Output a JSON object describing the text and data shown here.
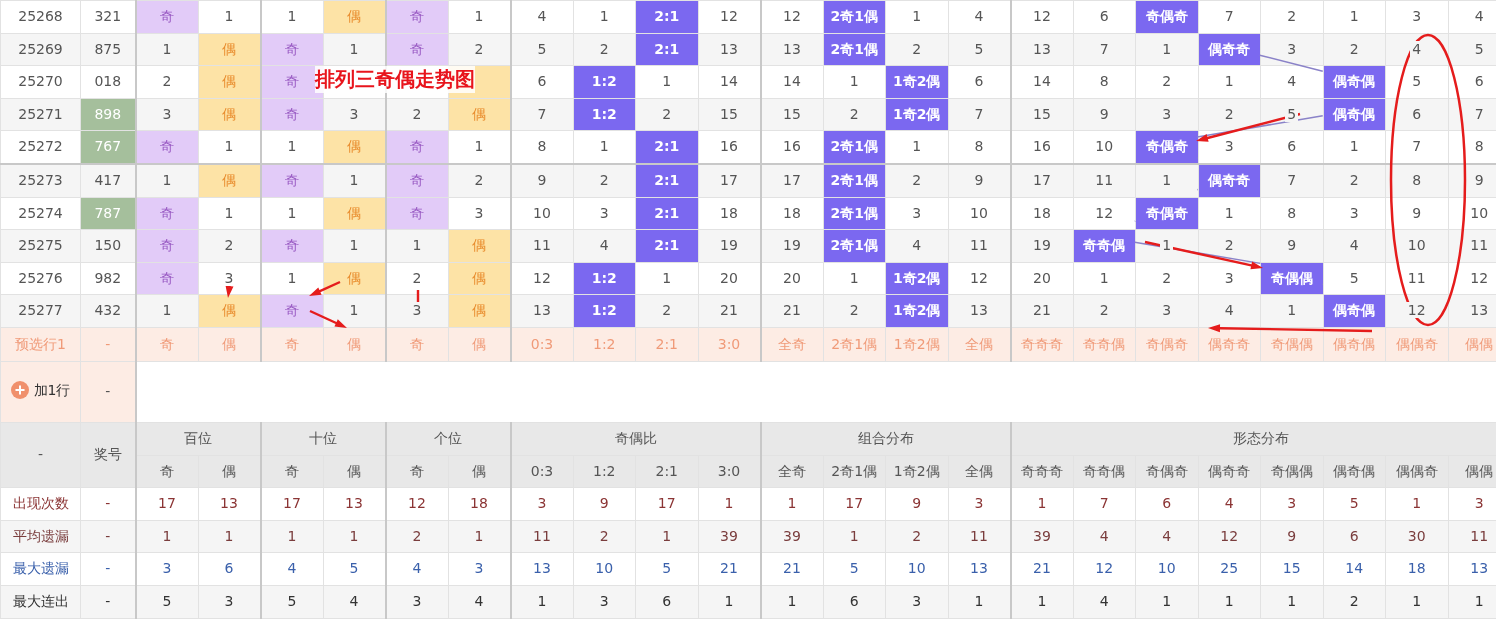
{
  "annotation": {
    "title": "排列三奇偶走势图"
  },
  "draws": [
    {
      "issue": "25268",
      "number": "321",
      "highlighted": false,
      "cells": [
        {
          "text": "奇",
          "kind": "odd"
        },
        {
          "text": "1",
          "kind": "plain"
        },
        {
          "text": "1",
          "kind": "plain"
        },
        {
          "text": "偶",
          "kind": "even"
        },
        {
          "text": "奇",
          "kind": "odd"
        },
        {
          "text": "1",
          "kind": "plain"
        },
        {
          "text": "4",
          "kind": "plain"
        },
        {
          "text": "1",
          "kind": "plain"
        },
        {
          "text": "2:1",
          "kind": "hit"
        },
        {
          "text": "12",
          "kind": "plain"
        },
        {
          "text": "12",
          "kind": "plain"
        },
        {
          "text": "2奇1偶",
          "kind": "hit"
        },
        {
          "text": "1",
          "kind": "plain"
        },
        {
          "text": "4",
          "kind": "plain"
        },
        {
          "text": "12",
          "kind": "plain"
        },
        {
          "text": "6",
          "kind": "plain"
        },
        {
          "text": "奇偶奇",
          "kind": "hit"
        },
        {
          "text": "7",
          "kind": "plain"
        },
        {
          "text": "2",
          "kind": "plain"
        },
        {
          "text": "1",
          "kind": "plain"
        },
        {
          "text": "3",
          "kind": "plain"
        },
        {
          "text": "4",
          "kind": "plain"
        }
      ]
    },
    {
      "issue": "25269",
      "number": "875",
      "highlighted": false,
      "cells": [
        {
          "text": "1",
          "kind": "plain"
        },
        {
          "text": "偶",
          "kind": "even"
        },
        {
          "text": "奇",
          "kind": "odd"
        },
        {
          "text": "1",
          "kind": "plain"
        },
        {
          "text": "奇",
          "kind": "odd"
        },
        {
          "text": "2",
          "kind": "plain"
        },
        {
          "text": "5",
          "kind": "plain"
        },
        {
          "text": "2",
          "kind": "plain"
        },
        {
          "text": "2:1",
          "kind": "hit"
        },
        {
          "text": "13",
          "kind": "plain"
        },
        {
          "text": "13",
          "kind": "plain"
        },
        {
          "text": "2奇1偶",
          "kind": "hit"
        },
        {
          "text": "2",
          "kind": "plain"
        },
        {
          "text": "5",
          "kind": "plain"
        },
        {
          "text": "13",
          "kind": "plain"
        },
        {
          "text": "7",
          "kind": "plain"
        },
        {
          "text": "1",
          "kind": "plain"
        },
        {
          "text": "偶奇奇",
          "kind": "hit"
        },
        {
          "text": "3",
          "kind": "plain"
        },
        {
          "text": "2",
          "kind": "plain"
        },
        {
          "text": "4",
          "kind": "plain"
        },
        {
          "text": "5",
          "kind": "plain"
        }
      ]
    },
    {
      "issue": "25270",
      "number": "018",
      "highlighted": false,
      "cells": [
        {
          "text": "2",
          "kind": "plain"
        },
        {
          "text": "偶",
          "kind": "even"
        },
        {
          "text": "奇",
          "kind": "odd"
        },
        {
          "kind": "plain"
        },
        {
          "kind": "plain"
        },
        {
          "kind": "even"
        },
        {
          "text": "6",
          "kind": "plain"
        },
        {
          "text": "1:2",
          "kind": "hit"
        },
        {
          "text": "1",
          "kind": "plain"
        },
        {
          "text": "14",
          "kind": "plain"
        },
        {
          "text": "14",
          "kind": "plain"
        },
        {
          "text": "1",
          "kind": "plain"
        },
        {
          "text": "1奇2偶",
          "kind": "hit"
        },
        {
          "text": "6",
          "kind": "plain"
        },
        {
          "text": "14",
          "kind": "plain"
        },
        {
          "text": "8",
          "kind": "plain"
        },
        {
          "text": "2",
          "kind": "plain"
        },
        {
          "text": "1",
          "kind": "plain"
        },
        {
          "text": "4",
          "kind": "plain"
        },
        {
          "text": "偶奇偶",
          "kind": "hit"
        },
        {
          "text": "5",
          "kind": "plain"
        },
        {
          "text": "6",
          "kind": "plain"
        }
      ]
    },
    {
      "issue": "25271",
      "number": "898",
      "highlighted": true,
      "cells": [
        {
          "text": "3",
          "kind": "plain"
        },
        {
          "text": "偶",
          "kind": "even"
        },
        {
          "text": "奇",
          "kind": "odd"
        },
        {
          "text": "3",
          "kind": "plain"
        },
        {
          "text": "2",
          "kind": "plain"
        },
        {
          "text": "偶",
          "kind": "even"
        },
        {
          "text": "7",
          "kind": "plain"
        },
        {
          "text": "1:2",
          "kind": "hit"
        },
        {
          "text": "2",
          "kind": "plain"
        },
        {
          "text": "15",
          "kind": "plain"
        },
        {
          "text": "15",
          "kind": "plain"
        },
        {
          "text": "2",
          "kind": "plain"
        },
        {
          "text": "1奇2偶",
          "kind": "hit"
        },
        {
          "text": "7",
          "kind": "plain"
        },
        {
          "text": "15",
          "kind": "plain"
        },
        {
          "text": "9",
          "kind": "plain"
        },
        {
          "text": "3",
          "kind": "plain"
        },
        {
          "text": "2",
          "kind": "plain"
        },
        {
          "text": "5",
          "kind": "plain"
        },
        {
          "text": "偶奇偶",
          "kind": "hit"
        },
        {
          "text": "6",
          "kind": "plain"
        },
        {
          "text": "7",
          "kind": "plain"
        }
      ]
    },
    {
      "issue": "25272",
      "number": "767",
      "highlighted": true,
      "cells": [
        {
          "text": "奇",
          "kind": "odd"
        },
        {
          "text": "1",
          "kind": "plain"
        },
        {
          "text": "1",
          "kind": "plain"
        },
        {
          "text": "偶",
          "kind": "even"
        },
        {
          "text": "奇",
          "kind": "odd"
        },
        {
          "text": "1",
          "kind": "plain"
        },
        {
          "text": "8",
          "kind": "plain"
        },
        {
          "text": "1",
          "kind": "plain"
        },
        {
          "text": "2:1",
          "kind": "hit"
        },
        {
          "text": "16",
          "kind": "plain"
        },
        {
          "text": "16",
          "kind": "plain"
        },
        {
          "text": "2奇1偶",
          "kind": "hit"
        },
        {
          "text": "1",
          "kind": "plain"
        },
        {
          "text": "8",
          "kind": "plain"
        },
        {
          "text": "16",
          "kind": "plain"
        },
        {
          "text": "10",
          "kind": "plain"
        },
        {
          "text": "奇偶奇",
          "kind": "hit"
        },
        {
          "text": "3",
          "kind": "plain"
        },
        {
          "text": "6",
          "kind": "plain"
        },
        {
          "text": "1",
          "kind": "plain"
        },
        {
          "text": "7",
          "kind": "plain"
        },
        {
          "text": "8",
          "kind": "plain"
        }
      ]
    },
    {
      "issue": "25273",
      "number": "417",
      "highlighted": false,
      "cells": [
        {
          "text": "1",
          "kind": "plain"
        },
        {
          "text": "偶",
          "kind": "even"
        },
        {
          "text": "奇",
          "kind": "odd"
        },
        {
          "text": "1",
          "kind": "plain"
        },
        {
          "text": "奇",
          "kind": "odd"
        },
        {
          "text": "2",
          "kind": "plain"
        },
        {
          "text": "9",
          "kind": "plain"
        },
        {
          "text": "2",
          "kind": "plain"
        },
        {
          "text": "2:1",
          "kind": "hit"
        },
        {
          "text": "17",
          "kind": "plain"
        },
        {
          "text": "17",
          "kind": "plain"
        },
        {
          "text": "2奇1偶",
          "kind": "hit"
        },
        {
          "text": "2",
          "kind": "plain"
        },
        {
          "text": "9",
          "kind": "plain"
        },
        {
          "text": "17",
          "kind": "plain"
        },
        {
          "text": "11",
          "kind": "plain"
        },
        {
          "text": "1",
          "kind": "plain"
        },
        {
          "text": "偶奇奇",
          "kind": "hit"
        },
        {
          "text": "7",
          "kind": "plain"
        },
        {
          "text": "2",
          "kind": "plain"
        },
        {
          "text": "8",
          "kind": "plain"
        },
        {
          "text": "9",
          "kind": "plain"
        }
      ]
    },
    {
      "issue": "25274",
      "number": "787",
      "highlighted": true,
      "cells": [
        {
          "text": "奇",
          "kind": "odd"
        },
        {
          "text": "1",
          "kind": "plain"
        },
        {
          "text": "1",
          "kind": "plain"
        },
        {
          "text": "偶",
          "kind": "even"
        },
        {
          "text": "奇",
          "kind": "odd"
        },
        {
          "text": "3",
          "kind": "plain"
        },
        {
          "text": "10",
          "kind": "plain"
        },
        {
          "text": "3",
          "kind": "plain"
        },
        {
          "text": "2:1",
          "kind": "hit"
        },
        {
          "text": "18",
          "kind": "plain"
        },
        {
          "text": "18",
          "kind": "plain"
        },
        {
          "text": "2奇1偶",
          "kind": "hit"
        },
        {
          "text": "3",
          "kind": "plain"
        },
        {
          "text": "10",
          "kind": "plain"
        },
        {
          "text": "18",
          "kind": "plain"
        },
        {
          "text": "12",
          "kind": "plain"
        },
        {
          "text": "奇偶奇",
          "kind": "hit"
        },
        {
          "text": "1",
          "kind": "plain"
        },
        {
          "text": "8",
          "kind": "plain"
        },
        {
          "text": "3",
          "kind": "plain"
        },
        {
          "text": "9",
          "kind": "plain"
        },
        {
          "text": "10",
          "kind": "plain"
        }
      ]
    },
    {
      "issue": "25275",
      "number": "150",
      "highlighted": false,
      "cells": [
        {
          "text": "奇",
          "kind": "odd"
        },
        {
          "text": "2",
          "kind": "plain"
        },
        {
          "text": "奇",
          "kind": "odd"
        },
        {
          "text": "1",
          "kind": "plain"
        },
        {
          "text": "1",
          "kind": "plain"
        },
        {
          "text": "偶",
          "kind": "even"
        },
        {
          "text": "11",
          "kind": "plain"
        },
        {
          "text": "4",
          "kind": "plain"
        },
        {
          "text": "2:1",
          "kind": "hit"
        },
        {
          "text": "19",
          "kind": "plain"
        },
        {
          "text": "19",
          "kind": "plain"
        },
        {
          "text": "2奇1偶",
          "kind": "hit"
        },
        {
          "text": "4",
          "kind": "plain"
        },
        {
          "text": "11",
          "kind": "plain"
        },
        {
          "text": "19",
          "kind": "plain"
        },
        {
          "text": "奇奇偶",
          "kind": "hit"
        },
        {
          "text": "1",
          "kind": "plain"
        },
        {
          "text": "2",
          "kind": "plain"
        },
        {
          "text": "9",
          "kind": "plain"
        },
        {
          "text": "4",
          "kind": "plain"
        },
        {
          "text": "10",
          "kind": "plain"
        },
        {
          "text": "11",
          "kind": "plain"
        }
      ]
    },
    {
      "issue": "25276",
      "number": "982",
      "highlighted": false,
      "cells": [
        {
          "text": "奇",
          "kind": "odd"
        },
        {
          "text": "3",
          "kind": "plain"
        },
        {
          "text": "1",
          "kind": "plain"
        },
        {
          "text": "偶",
          "kind": "even"
        },
        {
          "text": "2",
          "kind": "plain"
        },
        {
          "text": "偶",
          "kind": "even"
        },
        {
          "text": "12",
          "kind": "plain"
        },
        {
          "text": "1:2",
          "kind": "hit"
        },
        {
          "text": "1",
          "kind": "plain"
        },
        {
          "text": "20",
          "kind": "plain"
        },
        {
          "text": "20",
          "kind": "plain"
        },
        {
          "text": "1",
          "kind": "plain"
        },
        {
          "text": "1奇2偶",
          "kind": "hit"
        },
        {
          "text": "12",
          "kind": "plain"
        },
        {
          "text": "20",
          "kind": "plain"
        },
        {
          "text": "1",
          "kind": "plain"
        },
        {
          "text": "2",
          "kind": "plain"
        },
        {
          "text": "3",
          "kind": "plain"
        },
        {
          "text": "奇偶偶",
          "kind": "hit"
        },
        {
          "text": "5",
          "kind": "plain"
        },
        {
          "text": "11",
          "kind": "plain"
        },
        {
          "text": "12",
          "kind": "plain"
        }
      ]
    },
    {
      "issue": "25277",
      "number": "432",
      "highlighted": false,
      "cells": [
        {
          "text": "1",
          "kind": "plain"
        },
        {
          "text": "偶",
          "kind": "even"
        },
        {
          "text": "奇",
          "kind": "odd"
        },
        {
          "text": "1",
          "kind": "plain"
        },
        {
          "text": "3",
          "kind": "plain"
        },
        {
          "text": "偶",
          "kind": "even"
        },
        {
          "text": "13",
          "kind": "plain"
        },
        {
          "text": "1:2",
          "kind": "hit"
        },
        {
          "text": "2",
          "kind": "plain"
        },
        {
          "text": "21",
          "kind": "plain"
        },
        {
          "text": "21",
          "kind": "plain"
        },
        {
          "text": "2",
          "kind": "plain"
        },
        {
          "text": "1奇2偶",
          "kind": "hit"
        },
        {
          "text": "13",
          "kind": "plain"
        },
        {
          "text": "21",
          "kind": "plain"
        },
        {
          "text": "2",
          "kind": "plain"
        },
        {
          "text": "3",
          "kind": "plain"
        },
        {
          "text": "4",
          "kind": "plain"
        },
        {
          "text": "1",
          "kind": "plain"
        },
        {
          "text": "偶奇偶",
          "kind": "hit"
        },
        {
          "text": "12",
          "kind": "plain"
        },
        {
          "text": "13",
          "kind": "plain"
        }
      ]
    }
  ],
  "preselect_row": {
    "label": "预选行1",
    "number": "-",
    "options": [
      "奇",
      "偶",
      "奇",
      "偶",
      "奇",
      "偶",
      "0:3",
      "1:2",
      "2:1",
      "3:0",
      "全奇",
      "2奇1偶",
      "1奇2偶",
      "全偶",
      "奇奇奇",
      "奇奇偶",
      "奇偶奇",
      "偶奇奇",
      "奇偶偶",
      "偶奇偶",
      "偶偶奇",
      "偶偶"
    ]
  },
  "add_row": {
    "label": "加1行",
    "number": "-"
  },
  "stats": {
    "corner": "-",
    "number_header": "奖号",
    "groups": [
      {
        "title": "百位",
        "columns": [
          "奇",
          "偶"
        ]
      },
      {
        "title": "十位",
        "columns": [
          "奇",
          "偶"
        ]
      },
      {
        "title": "个位",
        "columns": [
          "奇",
          "偶"
        ]
      },
      {
        "title": "奇偶比",
        "columns": [
          "0:3",
          "1:2",
          "2:1",
          "3:0"
        ]
      },
      {
        "title": "组合分布",
        "columns": [
          "全奇",
          "2奇1偶",
          "1奇2偶",
          "全偶"
        ]
      },
      {
        "title": "形态分布",
        "columns": [
          "奇奇奇",
          "奇奇偶",
          "奇偶奇",
          "偶奇奇",
          "奇偶偶",
          "偶奇偶",
          "偶偶奇",
          "偶偶"
        ]
      }
    ],
    "rows": [
      {
        "label": "出现次数",
        "kind": "count",
        "number": "-",
        "values": [
          "17",
          "13",
          "17",
          "13",
          "12",
          "18",
          "3",
          "9",
          "17",
          "1",
          "1",
          "17",
          "9",
          "3",
          "1",
          "7",
          "6",
          "4",
          "3",
          "5",
          "1",
          "3"
        ]
      },
      {
        "label": "平均遗漏",
        "kind": "avg_miss",
        "number": "-",
        "values": [
          "1",
          "1",
          "1",
          "1",
          "2",
          "1",
          "11",
          "2",
          "1",
          "39",
          "39",
          "1",
          "2",
          "11",
          "39",
          "4",
          "4",
          "12",
          "9",
          "6",
          "30",
          "11"
        ]
      },
      {
        "label": "最大遗漏",
        "kind": "max_miss",
        "number": "-",
        "values": [
          "3",
          "6",
          "4",
          "5",
          "4",
          "3",
          "13",
          "10",
          "5",
          "21",
          "21",
          "5",
          "10",
          "13",
          "21",
          "12",
          "10",
          "25",
          "15",
          "14",
          "18",
          "13"
        ]
      },
      {
        "label": "最大连出",
        "kind": "max_streak",
        "number": "-",
        "values": [
          "5",
          "3",
          "5",
          "4",
          "3",
          "4",
          "1",
          "3",
          "6",
          "1",
          "1",
          "6",
          "3",
          "1",
          "1",
          "4",
          "1",
          "1",
          "1",
          "2",
          "1",
          "1"
        ]
      }
    ]
  }
}
